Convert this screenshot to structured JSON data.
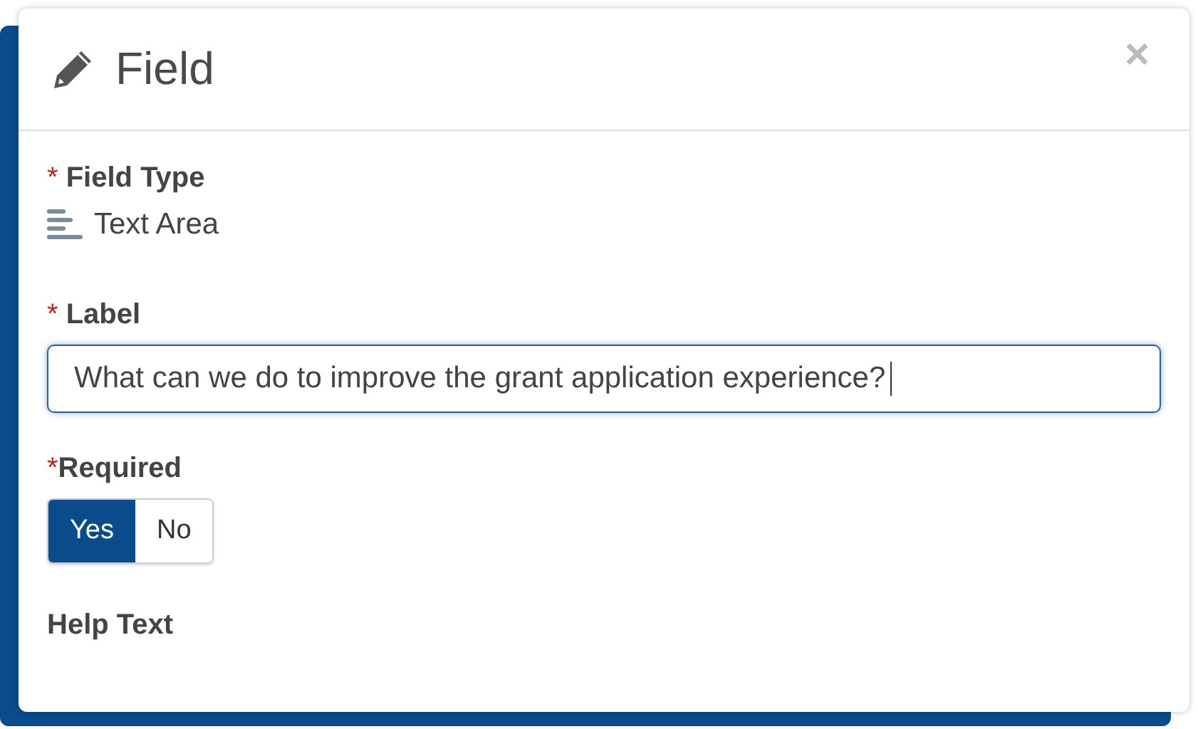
{
  "dialog": {
    "title": "Field",
    "close": "×"
  },
  "fields": [
    {
      "kind": "type",
      "marker": "* ",
      "label": "Field Type",
      "value": "Text Area"
    },
    {
      "kind": "input",
      "marker": "* ",
      "label": "Label",
      "value": "What can we do to improve the grant application experience?",
      "focused": true
    },
    {
      "kind": "toggle",
      "marker": "*",
      "label": "Required",
      "options": [
        {
          "label": "Yes",
          "selected": true
        },
        {
          "label": "No",
          "selected": false
        }
      ]
    },
    {
      "kind": "help",
      "label": "Help Text"
    }
  ]
}
